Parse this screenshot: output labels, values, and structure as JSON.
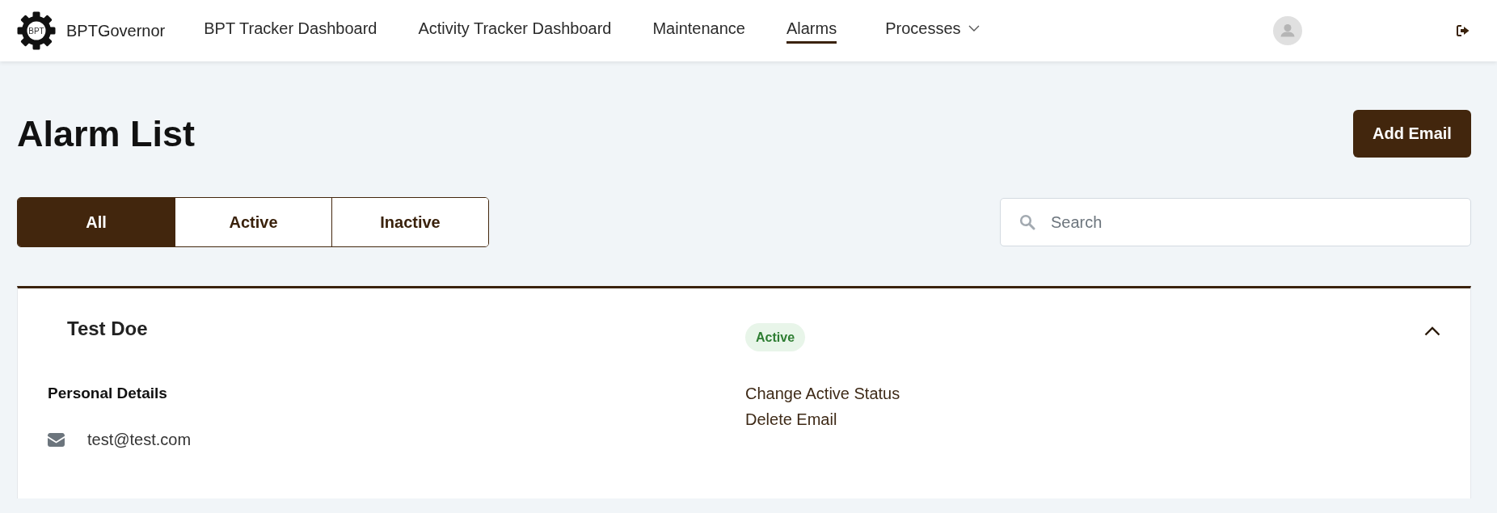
{
  "header": {
    "logo_text": "BPT",
    "brand": "BPTGovernor",
    "nav": [
      {
        "label": "BPT Tracker Dashboard",
        "kind": "link",
        "selected": false
      },
      {
        "label": "Activity Tracker Dashboard",
        "kind": "link",
        "selected": false
      },
      {
        "label": "Maintenance",
        "kind": "link",
        "selected": false
      },
      {
        "label": "Alarms",
        "kind": "link",
        "selected": true
      },
      {
        "label": "Processes",
        "kind": "dropdown",
        "selected": false
      }
    ]
  },
  "page": {
    "title": "Alarm List",
    "add_button": "Add Email"
  },
  "filter_tabs": [
    {
      "label": "All",
      "selected": true
    },
    {
      "label": "Active",
      "selected": false
    },
    {
      "label": "Inactive",
      "selected": false
    }
  ],
  "search": {
    "placeholder": "Search"
  },
  "alarms": [
    {
      "name": "Test Doe",
      "status": "Active",
      "active": true,
      "expanded": true,
      "details_heading": "Personal Details",
      "email": "test@test.com",
      "actions": [
        "Change Active Status",
        "Delete Email"
      ]
    }
  ]
}
